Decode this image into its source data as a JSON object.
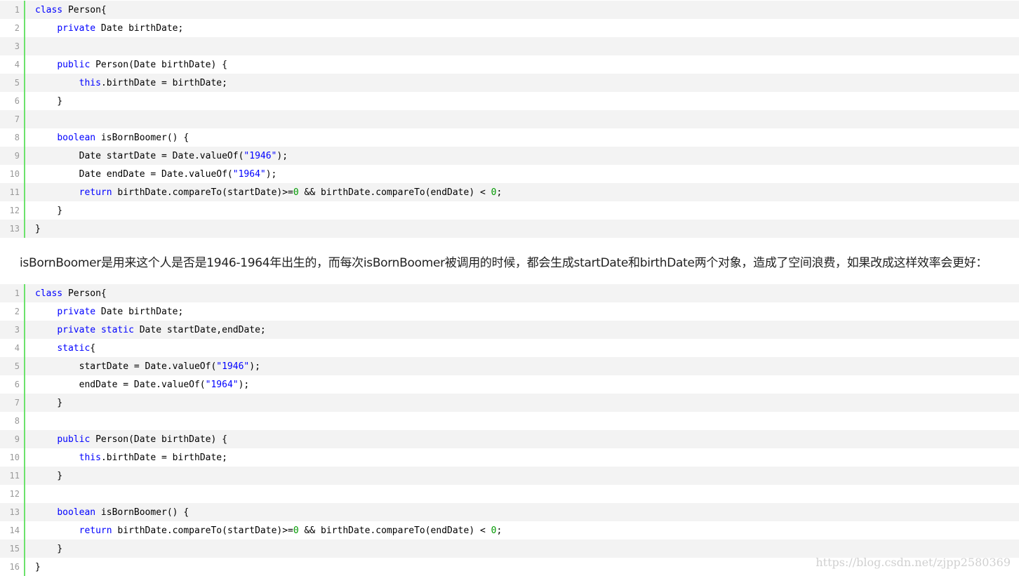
{
  "colors": {
    "gutter_bar": "#6ce26c",
    "keyword": "#0000ff",
    "number": "#009900",
    "odd_row_bg": "#f3f3f3"
  },
  "code_block_1": {
    "lines": [
      {
        "num": "1",
        "tokens": [
          {
            "t": "class",
            "c": "kw"
          },
          {
            "t": " Person{",
            "c": ""
          }
        ]
      },
      {
        "num": "2",
        "tokens": [
          {
            "t": "    ",
            "c": ""
          },
          {
            "t": "private",
            "c": "kw"
          },
          {
            "t": " Date birthDate;",
            "c": ""
          }
        ]
      },
      {
        "num": "3",
        "tokens": []
      },
      {
        "num": "4",
        "tokens": [
          {
            "t": "    ",
            "c": ""
          },
          {
            "t": "public",
            "c": "kw"
          },
          {
            "t": " Person(Date birthDate) {",
            "c": ""
          }
        ]
      },
      {
        "num": "5",
        "tokens": [
          {
            "t": "        ",
            "c": ""
          },
          {
            "t": "this",
            "c": "kw"
          },
          {
            "t": ".birthDate = birthDate;",
            "c": ""
          }
        ]
      },
      {
        "num": "6",
        "tokens": [
          {
            "t": "    }",
            "c": ""
          }
        ]
      },
      {
        "num": "7",
        "tokens": []
      },
      {
        "num": "8",
        "tokens": [
          {
            "t": "    ",
            "c": ""
          },
          {
            "t": "boolean",
            "c": "kw"
          },
          {
            "t": " isBornBoomer() {",
            "c": ""
          }
        ]
      },
      {
        "num": "9",
        "tokens": [
          {
            "t": "        Date startDate = Date.valueOf(",
            "c": ""
          },
          {
            "t": "\"1946\"",
            "c": "str"
          },
          {
            "t": ");",
            "c": ""
          }
        ]
      },
      {
        "num": "10",
        "tokens": [
          {
            "t": "        Date endDate = Date.valueOf(",
            "c": ""
          },
          {
            "t": "\"1964\"",
            "c": "str"
          },
          {
            "t": ");",
            "c": ""
          }
        ]
      },
      {
        "num": "11",
        "tokens": [
          {
            "t": "        ",
            "c": ""
          },
          {
            "t": "return",
            "c": "kw"
          },
          {
            "t": " birthDate.compareTo(startDate)>=",
            "c": ""
          },
          {
            "t": "0",
            "c": "num"
          },
          {
            "t": " && birthDate.compareTo(endDate) < ",
            "c": ""
          },
          {
            "t": "0",
            "c": "num"
          },
          {
            "t": ";",
            "c": ""
          }
        ]
      },
      {
        "num": "12",
        "tokens": [
          {
            "t": "    }",
            "c": ""
          }
        ]
      },
      {
        "num": "13",
        "tokens": [
          {
            "t": "}",
            "c": ""
          }
        ]
      }
    ]
  },
  "prose_text": "isBornBoomer是用来这个人是否是1946-1964年出生的，而每次isBornBoomer被调用的时候，都会生成startDate和birthDate两个对象，造成了空间浪费，如果改成这样效率会更好：",
  "code_block_2": {
    "lines": [
      {
        "num": "1",
        "tokens": [
          {
            "t": "class",
            "c": "kw"
          },
          {
            "t": " Person{",
            "c": ""
          }
        ]
      },
      {
        "num": "2",
        "tokens": [
          {
            "t": "    ",
            "c": ""
          },
          {
            "t": "private",
            "c": "kw"
          },
          {
            "t": " Date birthDate;",
            "c": ""
          }
        ]
      },
      {
        "num": "3",
        "tokens": [
          {
            "t": "    ",
            "c": ""
          },
          {
            "t": "private",
            "c": "kw"
          },
          {
            "t": " ",
            "c": ""
          },
          {
            "t": "static",
            "c": "kw"
          },
          {
            "t": " Date startDate,endDate;",
            "c": ""
          }
        ]
      },
      {
        "num": "4",
        "tokens": [
          {
            "t": "    ",
            "c": ""
          },
          {
            "t": "static",
            "c": "kw"
          },
          {
            "t": "{",
            "c": ""
          }
        ]
      },
      {
        "num": "5",
        "tokens": [
          {
            "t": "        startDate = Date.valueOf(",
            "c": ""
          },
          {
            "t": "\"1946\"",
            "c": "str"
          },
          {
            "t": ");",
            "c": ""
          }
        ]
      },
      {
        "num": "6",
        "tokens": [
          {
            "t": "        endDate = Date.valueOf(",
            "c": ""
          },
          {
            "t": "\"1964\"",
            "c": "str"
          },
          {
            "t": ");",
            "c": ""
          }
        ]
      },
      {
        "num": "7",
        "tokens": [
          {
            "t": "    }",
            "c": ""
          }
        ]
      },
      {
        "num": "8",
        "tokens": []
      },
      {
        "num": "9",
        "tokens": [
          {
            "t": "    ",
            "c": ""
          },
          {
            "t": "public",
            "c": "kw"
          },
          {
            "t": " Person(Date birthDate) {",
            "c": ""
          }
        ]
      },
      {
        "num": "10",
        "tokens": [
          {
            "t": "        ",
            "c": ""
          },
          {
            "t": "this",
            "c": "kw"
          },
          {
            "t": ".birthDate = birthDate;",
            "c": ""
          }
        ]
      },
      {
        "num": "11",
        "tokens": [
          {
            "t": "    }",
            "c": ""
          }
        ]
      },
      {
        "num": "12",
        "tokens": []
      },
      {
        "num": "13",
        "tokens": [
          {
            "t": "    ",
            "c": ""
          },
          {
            "t": "boolean",
            "c": "kw"
          },
          {
            "t": " isBornBoomer() {",
            "c": ""
          }
        ]
      },
      {
        "num": "14",
        "tokens": [
          {
            "t": "        ",
            "c": ""
          },
          {
            "t": "return",
            "c": "kw"
          },
          {
            "t": " birthDate.compareTo(startDate)>=",
            "c": ""
          },
          {
            "t": "0",
            "c": "num"
          },
          {
            "t": " && birthDate.compareTo(endDate) < ",
            "c": ""
          },
          {
            "t": "0",
            "c": "num"
          },
          {
            "t": ";",
            "c": ""
          }
        ]
      },
      {
        "num": "15",
        "tokens": [
          {
            "t": "    }",
            "c": ""
          }
        ]
      },
      {
        "num": "16",
        "tokens": [
          {
            "t": "}",
            "c": ""
          }
        ]
      }
    ]
  },
  "watermark": "https://blog.csdn.net/zjpp2580369"
}
